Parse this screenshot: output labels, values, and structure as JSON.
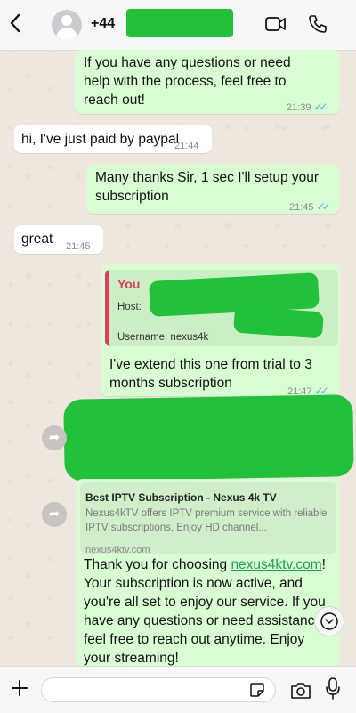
{
  "header": {
    "back_icon": "chevron-left-icon",
    "contact_name": "+44",
    "video_icon": "video-camera-icon",
    "call_icon": "phone-icon"
  },
  "messages": [
    {
      "type": "out",
      "text": "If you have any questions or need help with the process, feel free to reach out!",
      "time": "21:39"
    },
    {
      "type": "in",
      "text": "hi, I've just paid by paypal",
      "time": "21:44"
    },
    {
      "type": "out",
      "text": "Many thanks Sir, 1 sec I'll setup your subscription",
      "time": "21:45"
    },
    {
      "type": "in",
      "text": "great",
      "time": "21:45"
    },
    {
      "type": "out",
      "quote_author": "You",
      "quote_host_label": "Host:",
      "quote_username_label": "Username: nexus4k",
      "text": "I've extend this one from trial to 3 months subscription",
      "time": "21:47"
    },
    {
      "type": "out",
      "link_title": "Best IPTV Subscription - Nexus 4k TV",
      "link_desc": "Nexus4kTV offers IPTV premium service with reliable IPTV subscriptions. Enjoy HD channel...",
      "link_domain": "nexus4ktv.com",
      "text_before": "Thank you for choosing ",
      "link_text": "nexus4ktv.com",
      "text_after": "! Your subscription is now active, and you're all set to enjoy our service. If you have any questions or need assistance, feel free to reach out anytime. Enjoy your streaming!"
    }
  ],
  "input": {
    "placeholder": "",
    "plus_icon": "plus-icon",
    "sticker_icon": "sticker-icon",
    "camera_icon": "camera-icon",
    "mic_icon": "microphone-icon"
  },
  "colors": {
    "outgoing_bubble": "#d9fdd3",
    "incoming_bubble": "#ffffff",
    "redaction": "#21c13a",
    "read_tick": "#4fb6ec",
    "quote_author": "#e23b5f"
  }
}
